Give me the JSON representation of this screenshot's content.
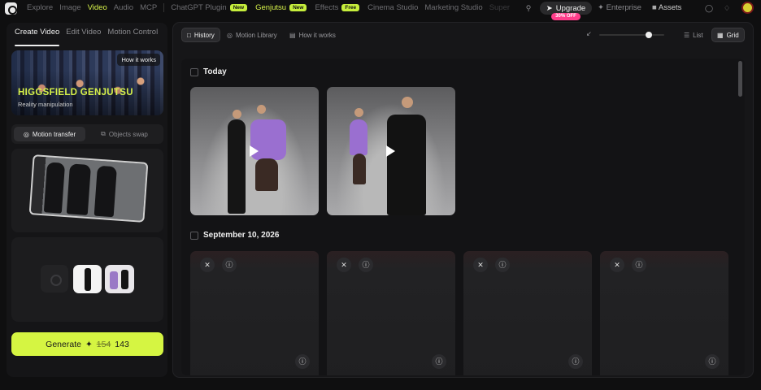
{
  "nav": {
    "items": [
      {
        "label": "Explore"
      },
      {
        "label": "Image"
      },
      {
        "label": "Video"
      },
      {
        "label": "Audio"
      },
      {
        "label": "MCP"
      },
      {
        "label": "ChatGPT Plugin"
      },
      {
        "label": "New"
      },
      {
        "label": "Genjutsu"
      },
      {
        "label": "New"
      },
      {
        "label": "Effects"
      },
      {
        "label": "Free"
      },
      {
        "label": "Cinema Studio"
      },
      {
        "label": "Marketing Studio"
      },
      {
        "label": "Super"
      }
    ]
  },
  "top_right": {
    "upgrade": "Upgrade",
    "upgrade_badge": "30% OFF",
    "enterprise": "Enterprise",
    "assets": "Assets"
  },
  "left": {
    "tabs": [
      "Create Video",
      "Edit Video",
      "Motion Control"
    ],
    "hero": {
      "how": "How it works",
      "title": "HIGGSFIELD GENJUTSU",
      "subtitle": "Reality manipulation"
    },
    "seg": {
      "a": "Motion transfer",
      "b": "Objects swap"
    },
    "generate": {
      "label": "Generate",
      "old_cost": "154",
      "cost": "143"
    }
  },
  "main": {
    "tabs": {
      "history": "History",
      "motion_library": "Motion Library",
      "how": "How it works"
    },
    "view": {
      "list": "List",
      "grid": "Grid"
    },
    "sections": {
      "today": "Today",
      "date": "September 10, 2026"
    }
  },
  "colors": {
    "accent": "#d5f542",
    "badge_pink": "#ff3d8b",
    "purple": "#9a6fd0"
  }
}
